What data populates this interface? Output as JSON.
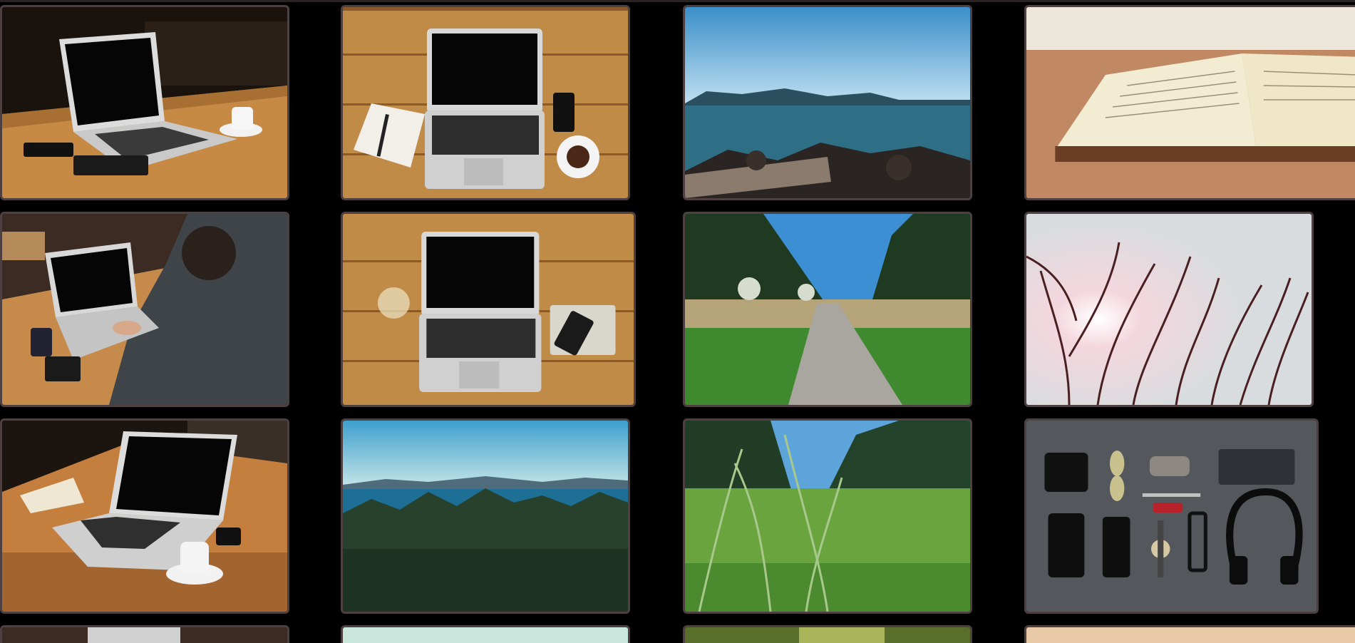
{
  "gallery": {
    "tiles": [
      {
        "icon": "photo-laptop-on-wooden-table"
      },
      {
        "icon": "photo-laptop-notebook-coffee-top-view"
      },
      {
        "icon": "photo-rocky-sea-coast"
      },
      {
        "icon": "photo-open-book"
      },
      {
        "icon": "photo-man-typing-on-laptop"
      },
      {
        "icon": "photo-laptop-glass-phone-top-view"
      },
      {
        "icon": "photo-forest-path"
      },
      {
        "icon": "photo-tree-branches-sunlight"
      },
      {
        "icon": "photo-laptop-coffee-notebook"
      },
      {
        "icon": "photo-forest-and-sea"
      },
      {
        "icon": "photo-grass-field"
      },
      {
        "icon": "photo-flat-lay-accessories"
      }
    ]
  }
}
